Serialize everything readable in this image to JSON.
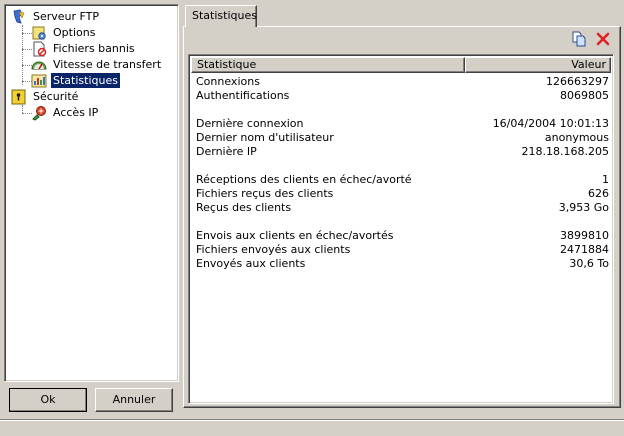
{
  "tree": {
    "items": [
      {
        "label": "Serveur FTP",
        "icon": "server-icon"
      },
      {
        "label": "Options",
        "icon": "options-icon"
      },
      {
        "label": "Fichiers bannis",
        "icon": "banned-files-icon"
      },
      {
        "label": "Vitesse de transfert",
        "icon": "speedometer-icon"
      },
      {
        "label": "Statistiques",
        "icon": "statistics-icon",
        "selected": true
      },
      {
        "label": "Sécurité",
        "icon": "lock-icon"
      },
      {
        "label": "Accès IP",
        "icon": "ip-access-icon"
      }
    ]
  },
  "buttons": {
    "ok": "Ok",
    "cancel": "Annuler"
  },
  "tab": {
    "label": "Statistiques"
  },
  "toolbar": {
    "copy_icon": "copy-icon",
    "delete_icon": "delete-icon"
  },
  "table": {
    "columns": [
      "Statistique",
      "Valeur"
    ],
    "rows": [
      {
        "key": "Connexions",
        "value": "126663297"
      },
      {
        "key": "Authentifications",
        "value": "8069805"
      },
      {
        "key": "",
        "value": ""
      },
      {
        "key": "Dernière connexion",
        "value": "16/04/2004 10:01:13"
      },
      {
        "key": "Dernier nom d'utilisateur",
        "value": "anonymous"
      },
      {
        "key": "Dernière IP",
        "value": "218.18.168.205"
      },
      {
        "key": "",
        "value": ""
      },
      {
        "key": "Réceptions des clients en échec/avorté",
        "value": "1"
      },
      {
        "key": "Fichiers reçus des clients",
        "value": "626"
      },
      {
        "key": "Reçus des clients",
        "value": "3,953 Go"
      },
      {
        "key": "",
        "value": ""
      },
      {
        "key": "Envois aux clients en échec/avortés",
        "value": "3899810"
      },
      {
        "key": "Fichiers envoyés aux clients",
        "value": "2471884"
      },
      {
        "key": "Envoyés aux clients",
        "value": "30,6 To"
      }
    ]
  }
}
